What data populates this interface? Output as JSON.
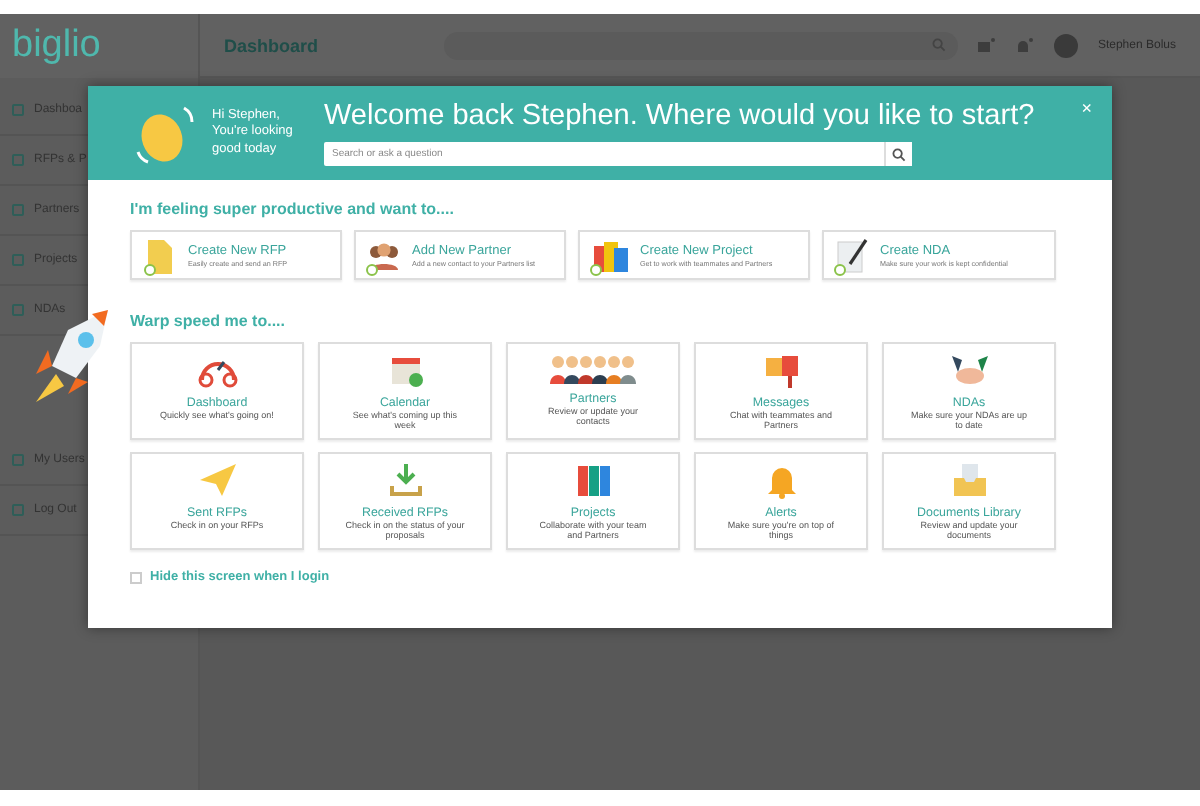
{
  "app": {
    "logo": "biglio",
    "page_title": "Dashboard",
    "user": "Stephen Bolus"
  },
  "sidebar": {
    "items": [
      {
        "label": "Dashboa"
      },
      {
        "label": "RFPs & P"
      },
      {
        "label": "Partners"
      },
      {
        "label": "Projects"
      },
      {
        "label": "NDAs"
      },
      {
        "label": "My Users"
      },
      {
        "label": "Log Out"
      }
    ]
  },
  "modal": {
    "greeting": "Hi Stephen, You're looking good today",
    "title": "Welcome back Stephen. Where would you like to start?",
    "search": {
      "placeholder": "Search or ask a question"
    },
    "close": "×",
    "quick_heading": "I'm feeling super productive and want to....",
    "quick_actions": [
      {
        "title": "Create New RFP",
        "subtitle": "Easily create and send an RFP"
      },
      {
        "title": "Add New Partner",
        "subtitle": "Add a new contact to your Partners list"
      },
      {
        "title": "Create New Project",
        "subtitle": "Get to work with teammates and Partners"
      },
      {
        "title": "Create NDA",
        "subtitle": "Make sure your work is kept confidential"
      }
    ],
    "warp_heading": "Warp speed me to....",
    "tiles": [
      {
        "title": "Dashboard",
        "subtitle": "Quickly see what's going on!"
      },
      {
        "title": "Calendar",
        "subtitle": "See what's coming up this week"
      },
      {
        "title": "Partners",
        "subtitle": "Review or update your contacts"
      },
      {
        "title": "Messages",
        "subtitle": "Chat with teammates and Partners"
      },
      {
        "title": "NDAs",
        "subtitle": "Make sure your NDAs are up to date"
      },
      {
        "title": "Sent RFPs",
        "subtitle": "Check in on your RFPs"
      },
      {
        "title": "Received RFPs",
        "subtitle": "Check in on the status of your proposals"
      },
      {
        "title": "Projects",
        "subtitle": "Collaborate with your team and Partners"
      },
      {
        "title": "Alerts",
        "subtitle": "Make sure you're on top of things"
      },
      {
        "title": "Documents Library",
        "subtitle": "Review and update your documents"
      }
    ],
    "hide_option": {
      "label": "Hide this screen when I login",
      "checked": false
    }
  }
}
